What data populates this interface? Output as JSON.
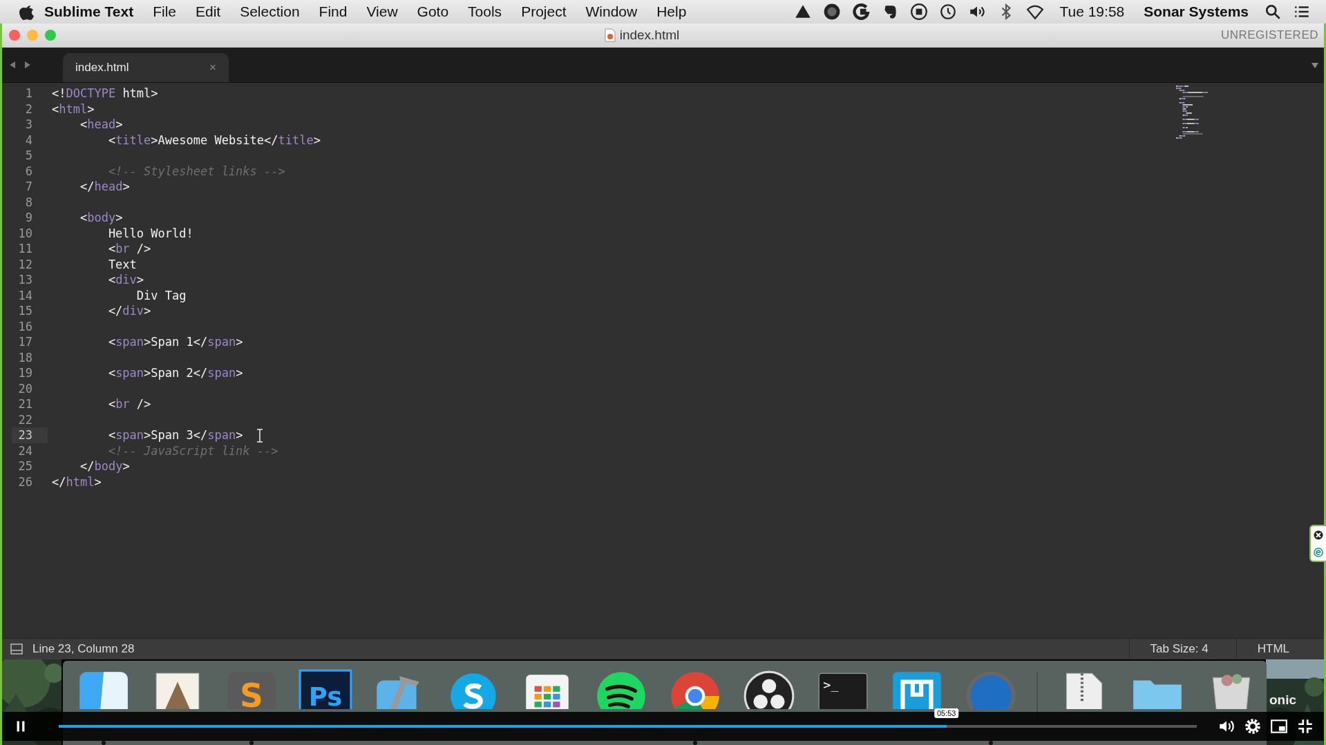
{
  "menubar": {
    "app_name": "Sublime Text",
    "menus": [
      "File",
      "Edit",
      "Selection",
      "Find",
      "View",
      "Goto",
      "Tools",
      "Project",
      "Window",
      "Help"
    ],
    "clock": "Tue 19:58",
    "user": "Sonar Systems"
  },
  "window": {
    "title": "index.html",
    "registration": "UNREGISTERED"
  },
  "tabs": [
    {
      "label": "index.html",
      "selected": true,
      "close": "×"
    }
  ],
  "editor": {
    "lines": [
      {
        "number": "1",
        "current": false,
        "tokens": [
          {
            "kind": "punct",
            "text": "<!"
          },
          {
            "kind": "tag",
            "text": "DOCTYPE"
          },
          {
            "kind": "punct",
            "text": " html>"
          }
        ]
      },
      {
        "number": "2",
        "current": false,
        "tokens": [
          {
            "kind": "punct",
            "text": "<"
          },
          {
            "kind": "tag",
            "text": "html"
          },
          {
            "kind": "punct",
            "text": ">"
          }
        ]
      },
      {
        "number": "3",
        "current": false,
        "tokens": [
          {
            "kind": "punct",
            "text": "    <"
          },
          {
            "kind": "tag",
            "text": "head"
          },
          {
            "kind": "punct",
            "text": ">"
          }
        ]
      },
      {
        "number": "4",
        "current": false,
        "tokens": [
          {
            "kind": "punct",
            "text": "        <"
          },
          {
            "kind": "tag",
            "text": "title"
          },
          {
            "kind": "punct",
            "text": ">Awesome Website</"
          },
          {
            "kind": "tag",
            "text": "title"
          },
          {
            "kind": "punct",
            "text": ">"
          }
        ]
      },
      {
        "number": "5",
        "current": false
      },
      {
        "number": "6",
        "current": false,
        "tokens": [
          {
            "kind": "comment",
            "text": "        <!-- Stylesheet links -->"
          }
        ]
      },
      {
        "number": "7",
        "current": false,
        "tokens": [
          {
            "kind": "punct",
            "text": "    </"
          },
          {
            "kind": "tag",
            "text": "head"
          },
          {
            "kind": "punct",
            "text": ">"
          }
        ]
      },
      {
        "number": "8",
        "current": false
      },
      {
        "number": "9",
        "current": false,
        "tokens": [
          {
            "kind": "punct",
            "text": "    <"
          },
          {
            "kind": "tag",
            "text": "body"
          },
          {
            "kind": "punct",
            "text": ">"
          }
        ]
      },
      {
        "number": "10",
        "current": false,
        "tokens": [
          {
            "kind": "punct",
            "text": "        Hello World!"
          }
        ]
      },
      {
        "number": "11",
        "current": false,
        "tokens": [
          {
            "kind": "punct",
            "text": "        <"
          },
          {
            "kind": "tag",
            "text": "br"
          },
          {
            "kind": "punct",
            "text": " />"
          }
        ]
      },
      {
        "number": "12",
        "current": false,
        "tokens": [
          {
            "kind": "punct",
            "text": "        Text"
          }
        ]
      },
      {
        "number": "13",
        "current": false,
        "tokens": [
          {
            "kind": "punct",
            "text": "        <"
          },
          {
            "kind": "tag",
            "text": "div"
          },
          {
            "kind": "punct",
            "text": ">"
          }
        ]
      },
      {
        "number": "14",
        "current": false,
        "tokens": [
          {
            "kind": "punct",
            "text": "            Div Tag"
          }
        ]
      },
      {
        "number": "15",
        "current": false,
        "tokens": [
          {
            "kind": "punct",
            "text": "        </"
          },
          {
            "kind": "tag",
            "text": "div"
          },
          {
            "kind": "punct",
            "text": ">"
          }
        ]
      },
      {
        "number": "16",
        "current": false
      },
      {
        "number": "17",
        "current": false,
        "tokens": [
          {
            "kind": "punct",
            "text": "        <"
          },
          {
            "kind": "tag",
            "text": "span"
          },
          {
            "kind": "punct",
            "text": ">Span 1</"
          },
          {
            "kind": "tag",
            "text": "span"
          },
          {
            "kind": "punct",
            "text": ">"
          }
        ]
      },
      {
        "number": "18",
        "current": false
      },
      {
        "number": "19",
        "current": false,
        "tokens": [
          {
            "kind": "punct",
            "text": "        <"
          },
          {
            "kind": "tag",
            "text": "span"
          },
          {
            "kind": "punct",
            "text": ">Span 2</"
          },
          {
            "kind": "tag",
            "text": "span"
          },
          {
            "kind": "punct",
            "text": ">"
          }
        ]
      },
      {
        "number": "20",
        "current": false
      },
      {
        "number": "21",
        "current": false,
        "tokens": [
          {
            "kind": "punct",
            "text": "        <"
          },
          {
            "kind": "tag",
            "text": "br"
          },
          {
            "kind": "punct",
            "text": " />"
          }
        ]
      },
      {
        "number": "22",
        "current": false
      },
      {
        "number": "23",
        "current": true,
        "tokens": [
          {
            "kind": "punct",
            "text": "        <"
          },
          {
            "kind": "tag",
            "text": "span"
          },
          {
            "kind": "punct",
            "text": ">Span 3</"
          },
          {
            "kind": "tag",
            "text": "span"
          },
          {
            "kind": "punct",
            "text": ">"
          }
        ]
      },
      {
        "number": "24",
        "current": false,
        "tokens": [
          {
            "kind": "comment",
            "text": "        <!-- JavaScript link -->"
          }
        ]
      },
      {
        "number": "25",
        "current": false,
        "tokens": [
          {
            "kind": "punct",
            "text": "    </"
          },
          {
            "kind": "tag",
            "text": "body"
          },
          {
            "kind": "punct",
            "text": ">"
          }
        ]
      },
      {
        "number": "26",
        "current": false,
        "tokens": [
          {
            "kind": "punct",
            "text": "</"
          },
          {
            "kind": "tag",
            "text": "html"
          },
          {
            "kind": "punct",
            "text": ">"
          }
        ]
      }
    ]
  },
  "status_bar": {
    "position": "Line 23, Column 28",
    "tab_size": "Tab Size: 4",
    "syntax": "HTML"
  },
  "desktop": {
    "side_text": "onic",
    "dock": [
      {
        "kind": "finder",
        "running": true
      },
      {
        "kind": "mail",
        "running": false
      },
      {
        "kind": "sublime",
        "label": "S",
        "running": true
      },
      {
        "kind": "photoshop",
        "label": "Ps",
        "running": false
      },
      {
        "kind": "xcode",
        "running": false
      },
      {
        "kind": "skype",
        "running": false
      },
      {
        "kind": "launchpad",
        "running": false
      },
      {
        "kind": "spotify",
        "running": false
      },
      {
        "kind": "chrome",
        "running": true
      },
      {
        "kind": "obs",
        "running": false
      },
      {
        "kind": "terminal",
        "label": ">_",
        "running": false
      },
      {
        "kind": "frame",
        "running": false
      },
      {
        "kind": "quicktime",
        "running": true
      },
      {
        "kind": "separator"
      },
      {
        "kind": "archive",
        "running": false
      },
      {
        "kind": "folder",
        "running": false
      },
      {
        "kind": "trash",
        "running": false
      }
    ]
  },
  "video_player": {
    "playing": true,
    "level": 0.78,
    "time": "05:53"
  }
}
